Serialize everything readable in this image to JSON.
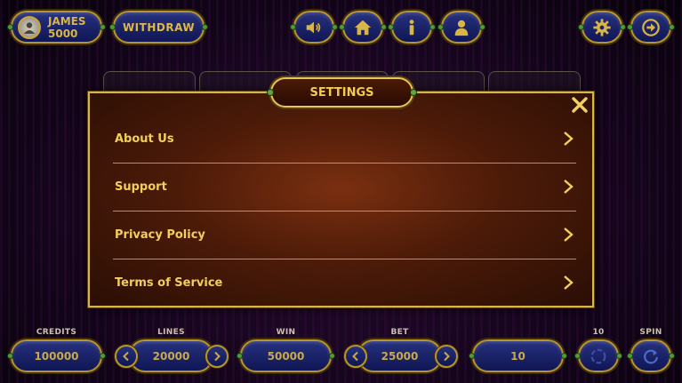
{
  "player": {
    "name": "JAMES",
    "balance": "5000"
  },
  "topbar": {
    "withdraw_label": "WITHDRAW"
  },
  "icons": {
    "sound": "speaker-icon",
    "home": "home-icon",
    "info": "info-icon",
    "user": "user-icon",
    "settings": "gear-icon",
    "exit": "exit-icon",
    "close": "close-icon",
    "chevron": "chevron-right-icon"
  },
  "modal": {
    "title": "SETTINGS",
    "items": [
      {
        "label": "About Us"
      },
      {
        "label": "Support"
      },
      {
        "label": "Privacy Policy"
      },
      {
        "label": "Terms of Service"
      }
    ]
  },
  "bottombar": {
    "credits": {
      "label": "CREDITS",
      "value": "100000"
    },
    "lines": {
      "label": "LINES",
      "value": "20000"
    },
    "win": {
      "label": "WIN",
      "value": "50000"
    },
    "bet": {
      "label": "BET",
      "value": "25000"
    },
    "ten": {
      "label": "10",
      "value": "10"
    },
    "spin": {
      "label": "SPIN"
    }
  },
  "colors": {
    "gold": "#d9b548",
    "navy": "#1a2268",
    "modal_bg": "#5a2009",
    "text_gold": "#f2cf5a"
  }
}
